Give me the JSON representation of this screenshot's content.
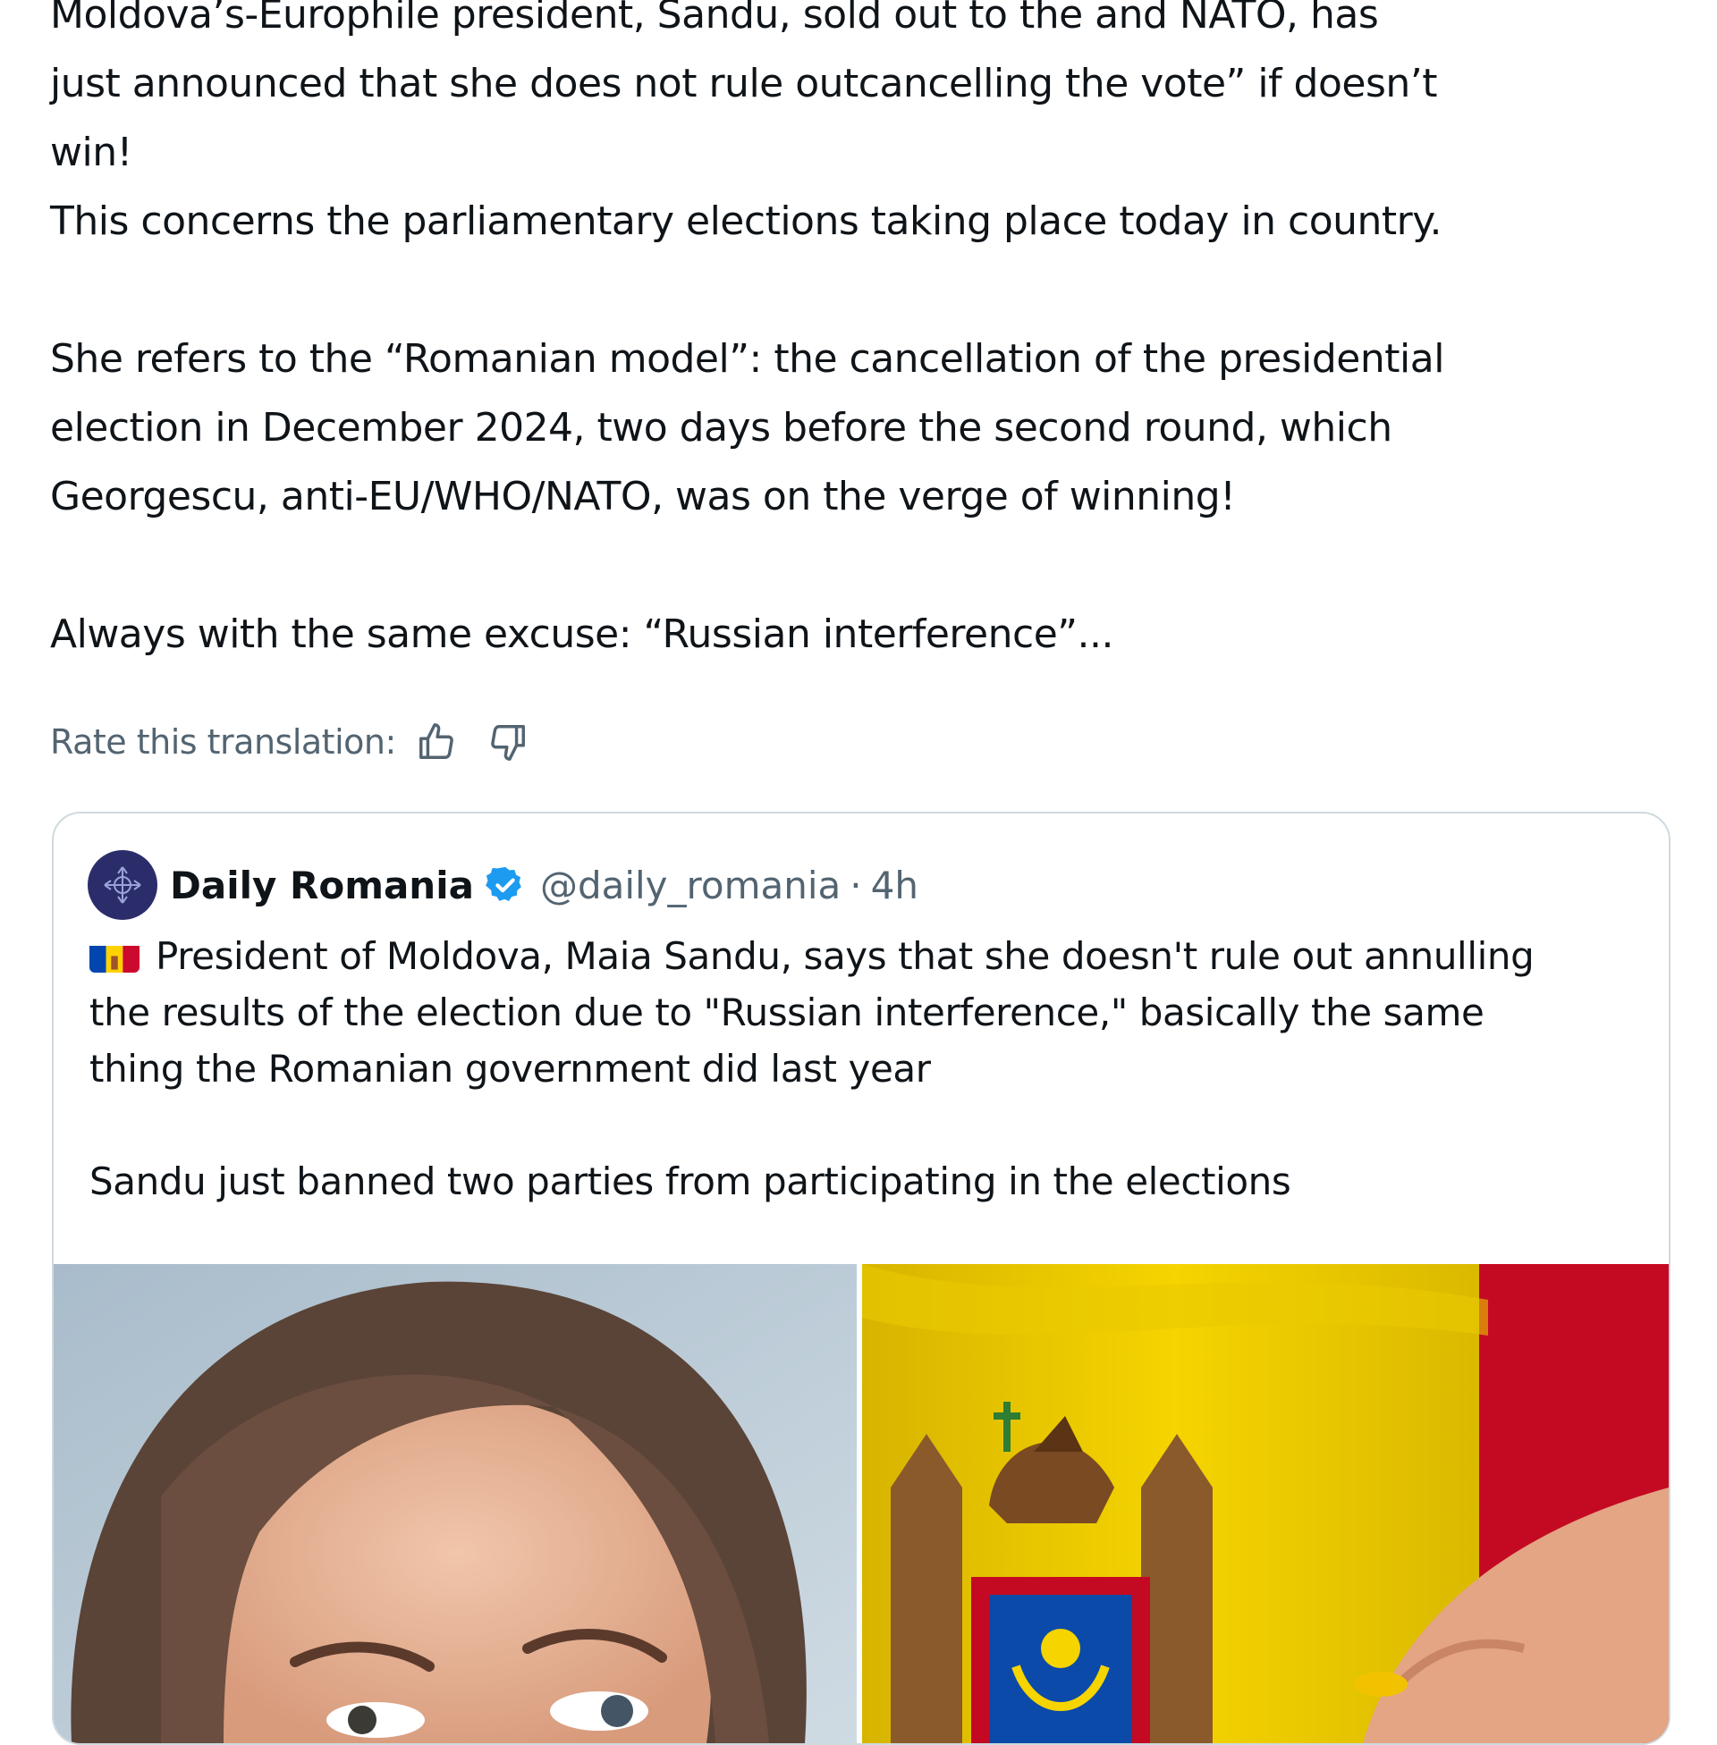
{
  "post": {
    "lines": [
      "Moldova’s-Europhile president, Sandu, sold out to the and NATO, has",
      "just announced that she does not rule outcancelling the vote” if doesn’t",
      "win!",
      "This concerns the parliamentary elections taking place today in country.",
      "",
      "She refers to the “Romanian model”: the cancellation of the presidential",
      "election in December 2024, two days before the second round, which",
      "Georgescu, anti-EU/WHO/NATO, was on the verge of winning!",
      "",
      "Always with the same excuse: “Russian interference”..."
    ]
  },
  "translation": {
    "rate_label": "Rate this translation:",
    "thumbs_up_icon": "thumbs-up-icon",
    "thumbs_down_icon": "thumbs-down-icon"
  },
  "quote": {
    "author_name": "Daily Romania",
    "handle": "@daily_romania",
    "separator": "·",
    "time": "4h",
    "verified_icon": "verified-badge-icon",
    "flag_icon": "moldova-flag-icon",
    "text_lines": [
      "President of Moldova, Maia Sandu, says that she doesn't rule out annulling",
      "the results of the election due to \"Russian interference,\" basically the same",
      "thing the Romanian government did last year",
      "",
      "Sandu just banned two parties from participating in the elections"
    ],
    "media": [
      {
        "name": "portrait-photo",
        "description_icon": "person-photo"
      },
      {
        "name": "flag-ballot-photo",
        "description_icon": "moldova-flag-ballot"
      }
    ]
  },
  "colors": {
    "text": "#0f1419",
    "secondary": "#536471",
    "border": "#cfd9de",
    "verified": "#1d9bf0",
    "flag_blue": "#0046ae",
    "flag_yellow": "#ffd200",
    "flag_red": "#cc092f"
  }
}
